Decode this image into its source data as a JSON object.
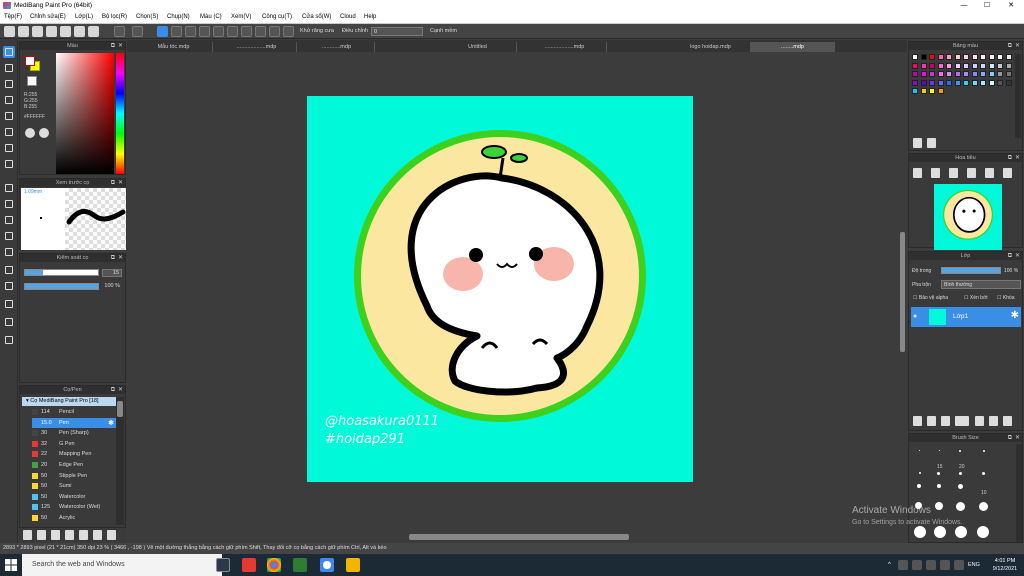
{
  "window": {
    "title": "MediBang Paint Pro (64bit)",
    "minimize": "—",
    "maximize": "☐",
    "close": "✕"
  },
  "menu": [
    "Tệp(F)",
    "Chỉnh sửa(E)",
    "Lớp(L)",
    "Bộ lọc(R)",
    "Chọn(S)",
    "Chụp(N)",
    "Màu (C)",
    "Xem(V)",
    "Công cụ(T)",
    "Cửa sổ(W)",
    "Cloud",
    "Help"
  ],
  "toolbar": {
    "snap_label": "Khử răng cưa",
    "adjust_label": "Điều chỉnh",
    "adjust_value": "0",
    "edge_label": "Cạnh mềm"
  },
  "tabs": [
    "Mẫu tóc.mdp",
    "...................mdp",
    "............mdp",
    "Untitled",
    "...................mdp",
    "logo hoidap.mdp",
    "........mdp"
  ],
  "color_panel": {
    "title": "Màu",
    "r": "R:255",
    "g": "G:255",
    "b": "B:255",
    "hex": "#FFFFFF",
    "accent": "#ff0000"
  },
  "preview_panel": {
    "title": "Xem trước cọ",
    "size": "1.09mm"
  },
  "brush_control": {
    "title": "Kiểm soát cọ",
    "size_value": "15",
    "opacity_value": "100 %",
    "size_fraction": 0.25,
    "opacity_fraction": 1.0
  },
  "brush_list": {
    "title": "Cọ/Pen",
    "group": "Cọ MediBang Paint Pro [18]",
    "items": [
      {
        "size": "114",
        "name": "Pencil",
        "color": "#444444"
      },
      {
        "size": "15.0",
        "name": "Pen",
        "color": "#3a8ee6"
      },
      {
        "size": "30",
        "name": "Pen (Sharp)",
        "color": "#444444"
      },
      {
        "size": "32",
        "name": "G Pen",
        "color": "#e53935"
      },
      {
        "size": "22",
        "name": "Mapping Pen",
        "color": "#e53935"
      },
      {
        "size": "20",
        "name": "Edge Pen",
        "color": "#43a047"
      },
      {
        "size": "50",
        "name": "Stipple Pen",
        "color": "#fdd835"
      },
      {
        "size": "50",
        "name": "Sumi",
        "color": "#fdd835"
      },
      {
        "size": "50",
        "name": "Watercolor",
        "color": "#4fc3f7"
      },
      {
        "size": "125",
        "name": "Watercolor (Wet)",
        "color": "#4fc3f7"
      },
      {
        "size": "50",
        "name": "Acrylic",
        "color": "#fdd835"
      }
    ]
  },
  "artwork": {
    "handle1": "@hoasakura0111",
    "handle2": "#hoidap291",
    "background": "#00f9d8",
    "ring": "#3dd11e",
    "inner": "#fce7a0"
  },
  "palette_panel": {
    "title": "Bảng màu"
  },
  "navigator_panel": {
    "title": "Hoa tiêu"
  },
  "layer_panel": {
    "title": "Lớp",
    "opacity_label": "Độ trong",
    "opacity_value": "100 %",
    "blend_label": "Pha trộn",
    "blend_value": "Bình thường",
    "protect_alpha": "Bảo vệ alpha",
    "clip": "Xén bớt",
    "lock": "Khóa",
    "layer_name": "Lớp1"
  },
  "brushsize_panel": {
    "title": "Brush Size",
    "labels": [
      "1",
      "1.5",
      "5",
      "7",
      "10",
      "15",
      "20",
      "30",
      "50",
      "70"
    ]
  },
  "status": "2893 * 2893 pixel  (21 * 21cm)  350 dpi  23 %  ( 3466 , -198 )  Vẽ một đường thẳng bằng cách giữ phím Shift, Thay đổi cỡ cọ bằng cách giữ phím Ctrl, Alt và kéo",
  "taskbar": {
    "search": "Search the web and Windows",
    "time": "4:01 PM",
    "date": "9/12/2021",
    "lang": "ENG"
  },
  "watermark": {
    "line1": "Activate Windows",
    "line2": "Go to Settings to activate Windows."
  }
}
